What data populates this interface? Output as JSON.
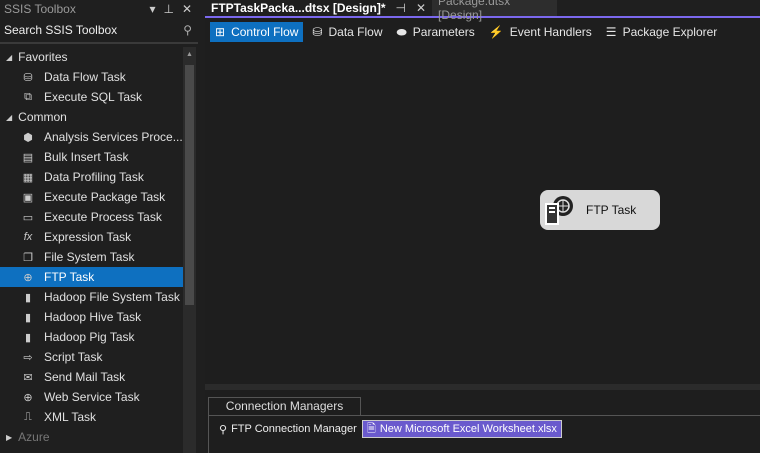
{
  "toolbox": {
    "title": "SSIS Toolbox",
    "search_placeholder": "Search SSIS Toolbox",
    "groups": [
      {
        "label": "Favorites",
        "items": [
          "Data Flow Task",
          "Execute SQL Task"
        ]
      },
      {
        "label": "Common",
        "items": [
          "Analysis Services Proce...",
          "Bulk Insert Task",
          "Data Profiling Task",
          "Execute Package Task",
          "Execute Process Task",
          "Expression Task",
          "File System Task",
          "FTP Task",
          "Hadoop File System Task",
          "Hadoop Hive Task",
          "Hadoop Pig Task",
          "Script Task",
          "Send Mail Task",
          "Web Service Task",
          "XML Task"
        ]
      },
      {
        "label": "Azure",
        "items": []
      }
    ],
    "selected": "FTP Task"
  },
  "doc_tabs": [
    {
      "label": "FTPTaskPacka...dtsx [Design]*",
      "active": true
    },
    {
      "label": "Package.dtsx [Design]",
      "active": false
    }
  ],
  "designer_tabs": [
    "Control Flow",
    "Data Flow",
    "Parameters",
    "Event Handlers",
    "Package Explorer"
  ],
  "canvas": {
    "task_label": "FTP Task"
  },
  "connection_managers": {
    "title": "Connection Managers",
    "items": [
      "FTP Connection Manager",
      "New Microsoft Excel Worksheet.xlsx"
    ]
  },
  "colors": {
    "accent": "#0e70c0",
    "tab_line": "#7b68ee",
    "selected_conn": "#6a5acd"
  }
}
